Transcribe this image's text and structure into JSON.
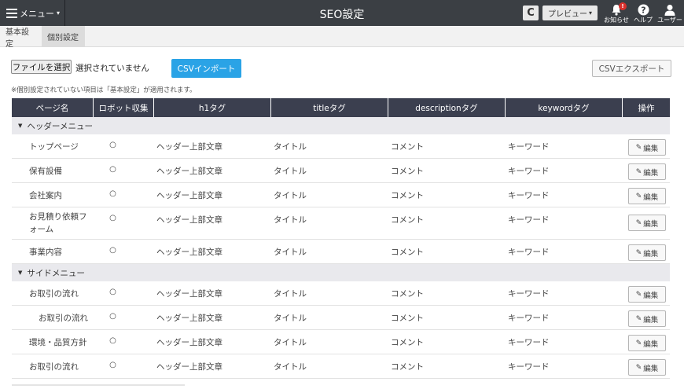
{
  "header": {
    "menu_label": "メニュー",
    "menu_caret": "▾",
    "title": "SEO設定",
    "reload_icon": "C",
    "preview_label": "プレビュー",
    "preview_caret": "▾",
    "notifications_label": "お知らせ",
    "notifications_badge": "!",
    "help_label": "ヘルプ",
    "user_label": "ユーザー"
  },
  "tabs": [
    {
      "label": "基本設定",
      "active": false
    },
    {
      "label": "個別設定",
      "active": true
    }
  ],
  "controls": {
    "file_button_label": "ファイルを選択",
    "file_status": "選択されていません",
    "import_label": "CSVインポート",
    "export_label": "CSVエクスポート",
    "note": "※個別設定されていない項目は「基本設定」が適用されます。"
  },
  "table": {
    "headers": [
      "ページ名",
      "ロボット収集",
      "h1タグ",
      "titleタグ",
      "descriptionタグ",
      "keywordタグ",
      "操作"
    ],
    "edit_label": "編集",
    "sections": [
      {
        "title": "ヘッダーメニュー",
        "rows": [
          {
            "page": "トップページ",
            "robot": "○",
            "h1": "ヘッダー上部文章",
            "title": "タイトル",
            "description": "コメント",
            "keyword": "キーワード"
          },
          {
            "page": "保有設備",
            "robot": "○",
            "h1": "ヘッダー上部文章",
            "title": "タイトル",
            "description": "コメント",
            "keyword": "キーワード"
          },
          {
            "page": "会社案内",
            "robot": "○",
            "h1": "ヘッダー上部文章",
            "title": "タイトル",
            "description": "コメント",
            "keyword": "キーワード"
          },
          {
            "page": "お見積り依頼フォーム",
            "robot": "○",
            "h1": "ヘッダー上部文章",
            "title": "タイトル",
            "description": "コメント",
            "keyword": "キーワード"
          },
          {
            "page": "事業内容",
            "robot": "○",
            "h1": "ヘッダー上部文章",
            "title": "タイトル",
            "description": "コメント",
            "keyword": "キーワード"
          }
        ]
      },
      {
        "title": "サイドメニュー",
        "rows": [
          {
            "page": "お取引の流れ",
            "robot": "○",
            "h1": "ヘッダー上部文章",
            "title": "タイトル",
            "description": "コメント",
            "keyword": "キーワード"
          },
          {
            "page": "お取引の流れ",
            "robot": "○",
            "h1": "ヘッダー上部文章",
            "title": "タイトル",
            "description": "コメント",
            "keyword": "キーワード"
          },
          {
            "page": "環境・品質方針",
            "robot": "○",
            "h1": "ヘッダー上部文章",
            "title": "タイトル",
            "description": "コメント",
            "keyword": "キーワード"
          },
          {
            "page": "お取引の流れ",
            "robot": "○",
            "h1": "ヘッダー上部文章",
            "title": "タイトル",
            "description": "コメント",
            "keyword": "キーワード"
          }
        ]
      }
    ]
  },
  "colors": {
    "topbar": "#3b3f44",
    "table_header": "#3b3f4f",
    "import_button": "#2aa3e6",
    "badge": "#d9302c"
  }
}
